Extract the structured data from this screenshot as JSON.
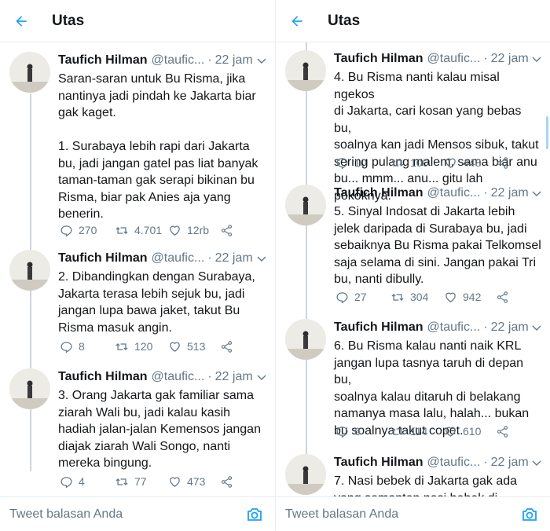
{
  "header": {
    "title": "Utas"
  },
  "author": {
    "name": "Taufich Hilman",
    "handle": "@taufic...",
    "dot": "·",
    "time": "22 jam"
  },
  "left_tweets": [
    {
      "text": "Saran-saran untuk Bu Risma, jika\nnantinya jadi pindah ke Jakarta biar\ngak kaget.\n\n1. Surabaya lebih rapi dari Jakarta\nbu, jadi jangan gatel pas liat banyak\ntaman-taman gak serapi bikinan bu\nRisma, biar pak Anies aja yang\nbenerin.",
      "replies": "270",
      "retweets": "4.701",
      "likes": "12rb"
    },
    {
      "text": "2. Dibandingkan dengan Surabaya,\nJakarta terasa lebih sejuk bu, jadi\njangan lupa bawa jaket, takut Bu\nRisma masuk angin.",
      "replies": "8",
      "retweets": "120",
      "likes": "513"
    },
    {
      "text": "3. Orang Jakarta gak familiar sama\nziarah Wali bu, jadi kalau kasih\nhadiah jalan-jalan Kemensos jangan\ndiajak ziarah Wali Songo, nanti\nmereka bingung.",
      "replies": "4",
      "retweets": "77",
      "likes": "473"
    }
  ],
  "right_tweets": [
    {
      "text": "4. Bu Risma nanti kalau misal ngekos\ndi Jakarta, cari kosan yang bebas bu,\nsoalnya kan jadi Mensos sibuk, takut\nsering pulang malem, sama biar anu\nbu... mmm... anu... gitu lah pokoknya.",
      "replies": "10",
      "retweets": "100",
      "likes": "448"
    },
    {
      "text": "5. Sinyal Indosat di Jakarta lebih\njelek daripada di Surabaya bu, jadi\nsebaiknya Bu Risma pakai Telkomsel\nsaja selama di sini. Jangan pakai Tri\nbu, nanti dibully.",
      "replies": "27",
      "retweets": "304",
      "likes": "942"
    },
    {
      "text": "6. Bu Risma kalau nanti naik KRL\njangan lupa tasnya taruh di depan bu,\nsoalnya kalau ditaruh di belakang\nnamanya masa lalu, halah... bukan\nbu soalnya takut copet.",
      "replies": "6",
      "retweets": "114",
      "likes": "610"
    },
    {
      "text": "7. Nasi bebek di Jakarta gak ada\nyang semantep nasi bebek di",
      "replies": "",
      "retweets": "",
      "likes": ""
    }
  ],
  "footer": {
    "reply_placeholder": "Tweet balasan Anda"
  },
  "colors": {
    "accent": "#1da1f2",
    "muted": "#657786",
    "line": "#ccd6dd"
  },
  "icons": [
    "back-arrow-icon",
    "chevron-down-icon",
    "reply-icon",
    "retweet-icon",
    "like-icon",
    "share-icon",
    "camera-icon"
  ]
}
